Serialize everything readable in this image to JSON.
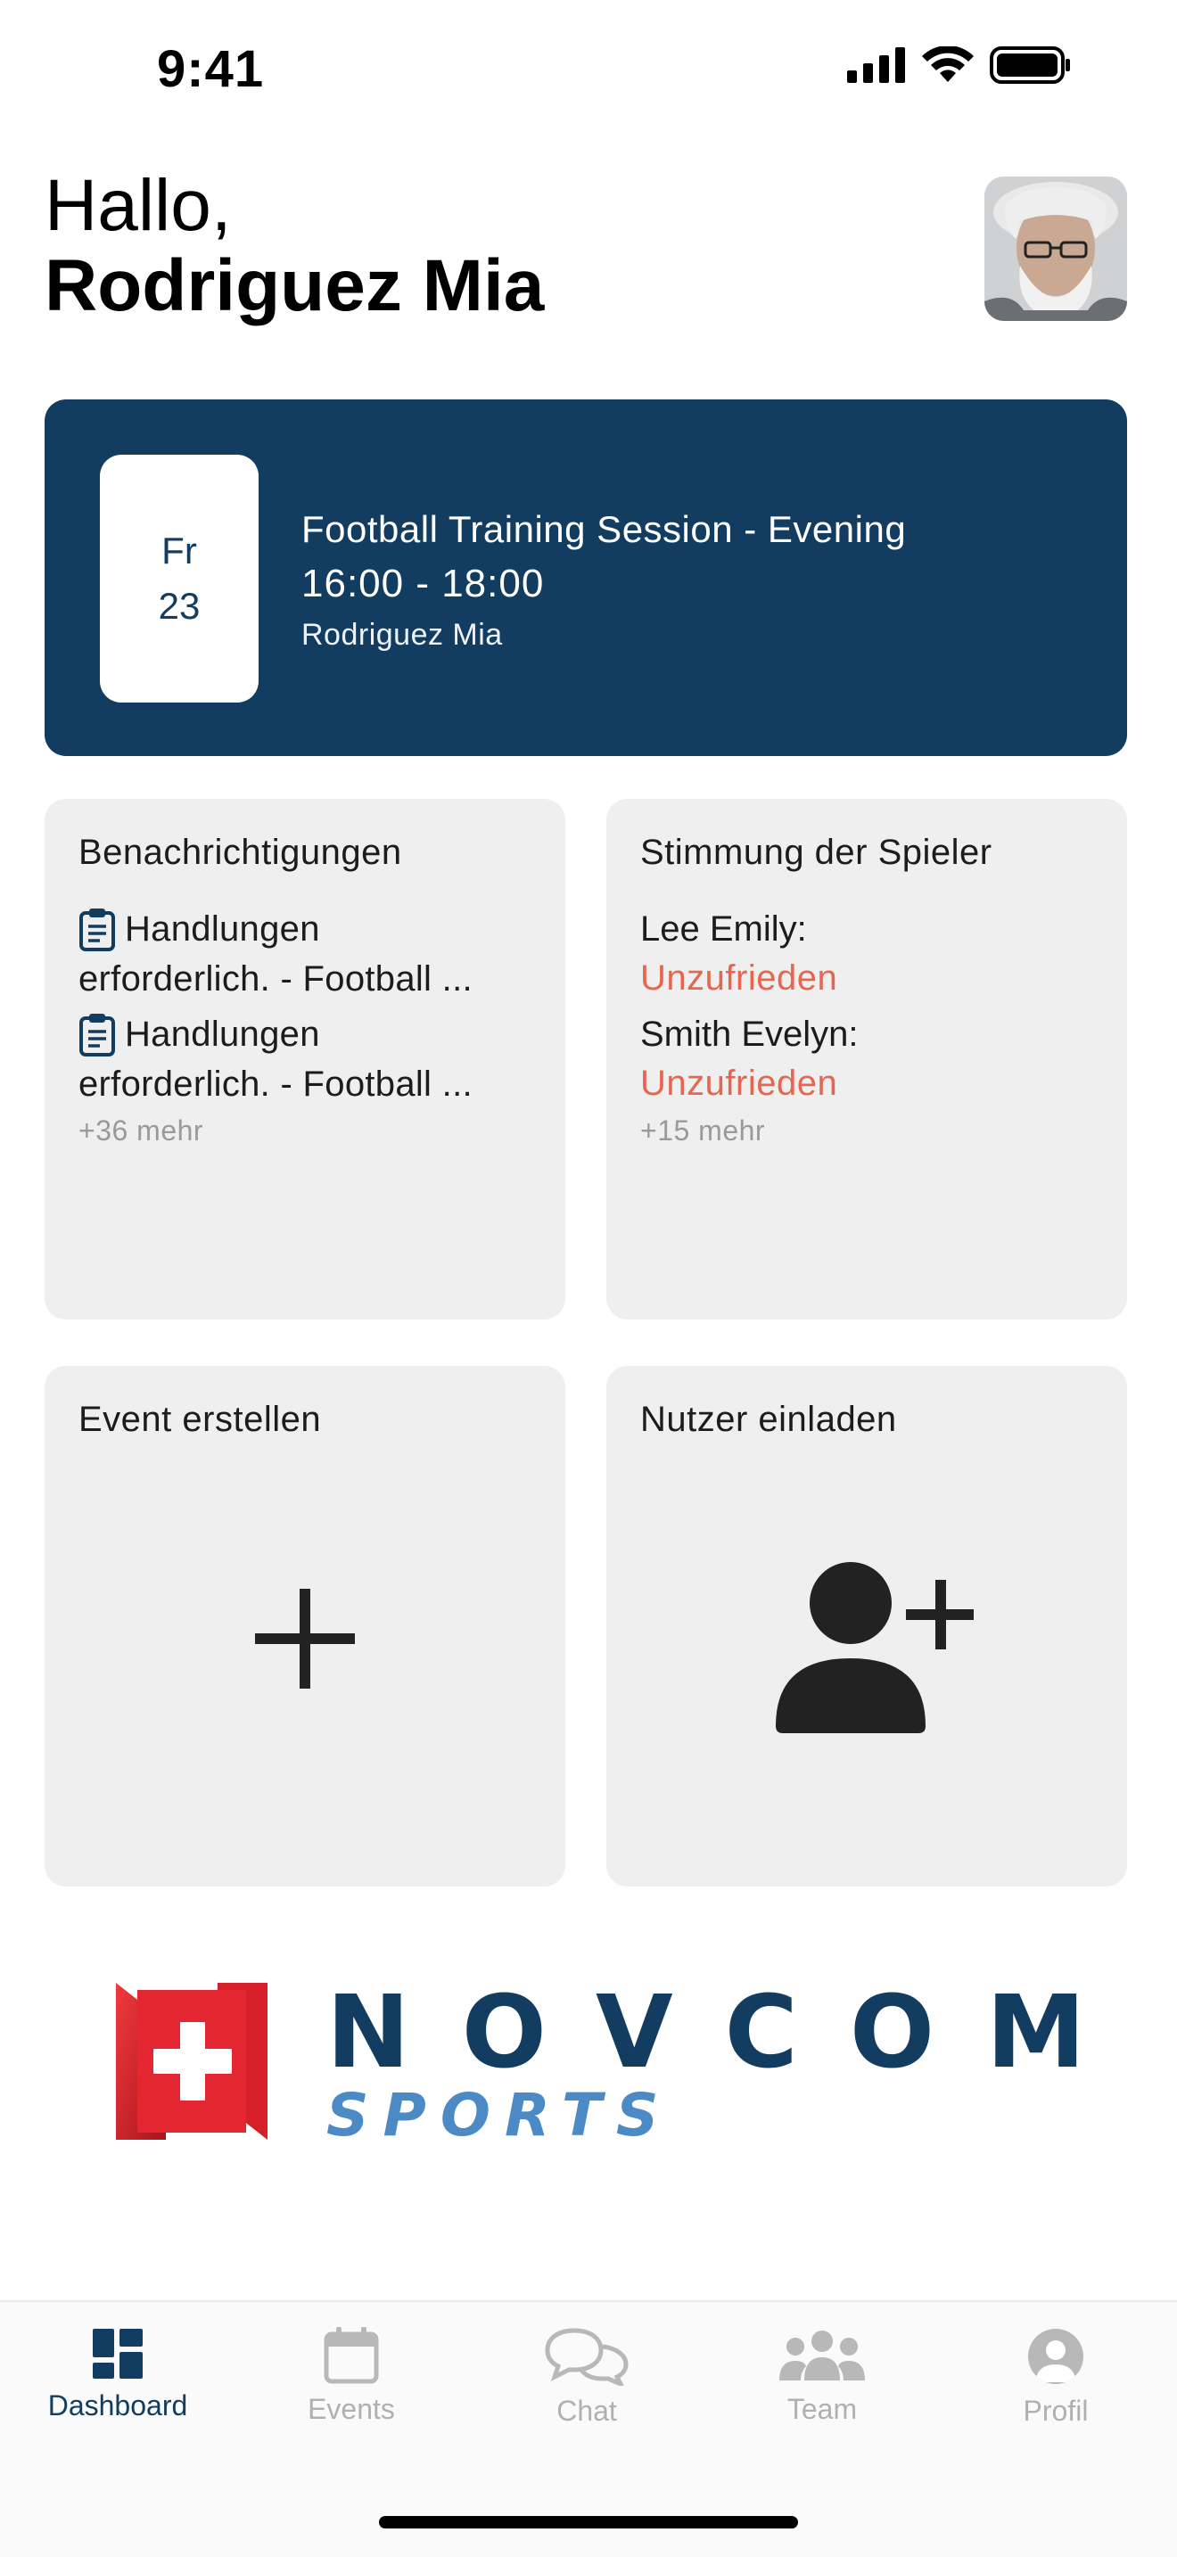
{
  "status_bar": {
    "time": "9:41"
  },
  "greeting": {
    "hello": "Hallo,",
    "name": "Rodriguez Mia"
  },
  "event_card": {
    "day": "Fr",
    "date": "23",
    "title": "Football Training Session - Evening",
    "time": "16:00 - 18:00",
    "owner": "Rodriguez Mia"
  },
  "notifications": {
    "title": "Benachrichtigungen",
    "items": [
      {
        "line1": "Handlungen",
        "line2": "erforderlich. - Football ..."
      },
      {
        "line1": "Handlungen",
        "line2": "erforderlich. - Football ..."
      }
    ],
    "more": "+36 mehr"
  },
  "mood": {
    "title": "Stimmung der Spieler",
    "items": [
      {
        "name": "Lee Emily:",
        "status": "Unzufrieden"
      },
      {
        "name": "Smith Evelyn:",
        "status": "Unzufrieden"
      }
    ],
    "more": "+15 mehr"
  },
  "create_event": {
    "title": "Event erstellen",
    "icon": "plus-icon"
  },
  "invite_user": {
    "title": "Nutzer einladen",
    "icon": "person-add-icon"
  },
  "logo": {
    "word": "NOVCOM",
    "sub": "SPORTS"
  },
  "tabs": [
    {
      "label": "Dashboard",
      "icon": "dashboard-icon",
      "active": true
    },
    {
      "label": "Events",
      "icon": "calendar-icon",
      "active": false
    },
    {
      "label": "Chat",
      "icon": "chat-icon",
      "active": false
    },
    {
      "label": "Team",
      "icon": "team-icon",
      "active": false
    },
    {
      "label": "Profil",
      "icon": "profile-icon",
      "active": false
    }
  ],
  "colors": {
    "primary": "#123d61",
    "accent_blue": "#4c8ac6",
    "unhappy": "#e7664f",
    "tile_bg": "#efefef",
    "logo_red": "#e3262f"
  }
}
